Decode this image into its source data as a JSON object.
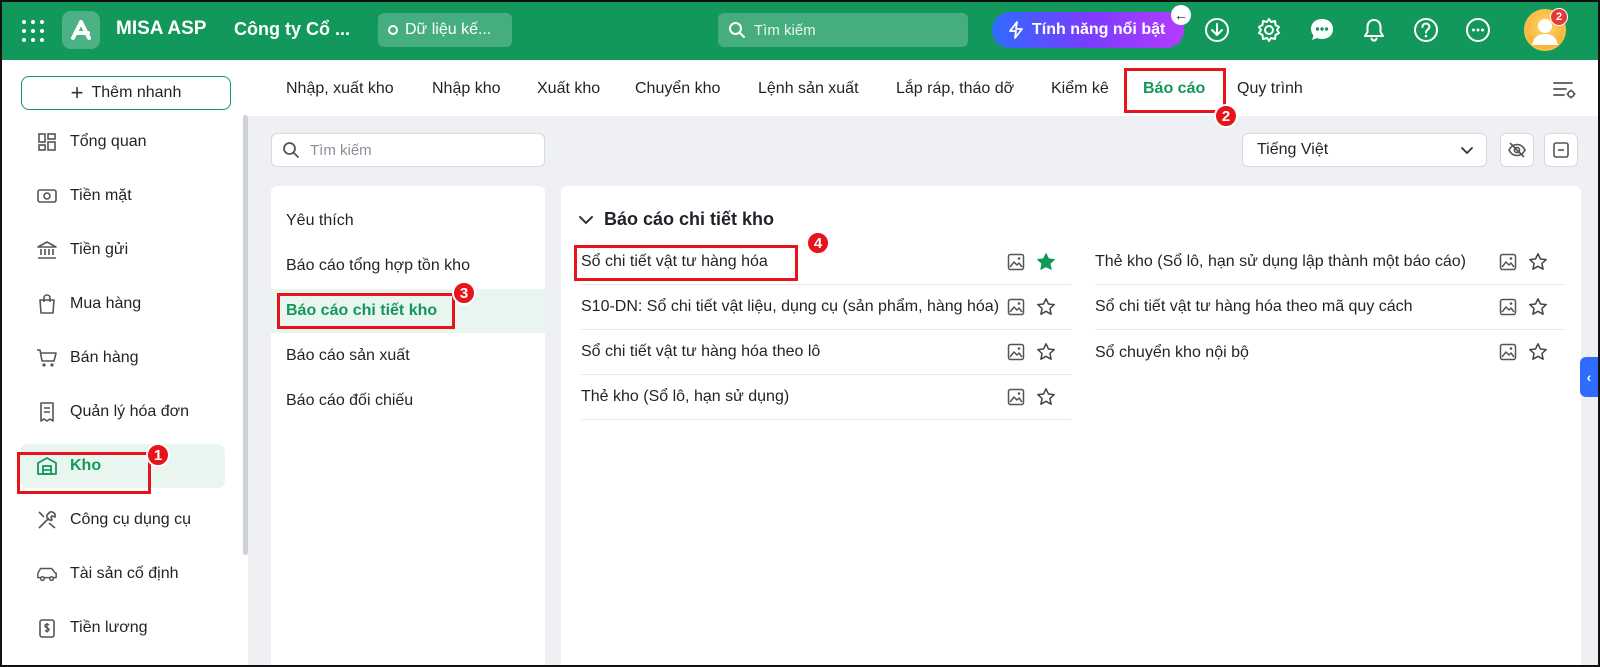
{
  "app": {
    "brand": "MISA ASP",
    "company": "Công ty Cổ ...",
    "data_label": "Dữ liệu kế...",
    "search_placeholder": "Tìm kiếm",
    "feature_button": "Tính năng nổi bật",
    "notification_count": "2"
  },
  "sidebar": {
    "quick_add": "Thêm nhanh",
    "items": [
      {
        "label": "Tổng quan"
      },
      {
        "label": "Tiền mặt"
      },
      {
        "label": "Tiền gửi"
      },
      {
        "label": "Mua hàng"
      },
      {
        "label": "Bán hàng"
      },
      {
        "label": "Quản lý hóa đơn"
      },
      {
        "label": "Kho"
      },
      {
        "label": "Công cụ dụng cụ"
      },
      {
        "label": "Tài sản cố định"
      },
      {
        "label": "Tiền lương"
      }
    ],
    "active": "Kho"
  },
  "tabs": [
    {
      "label": "Nhập, xuất kho"
    },
    {
      "label": "Nhập kho"
    },
    {
      "label": "Xuất kho"
    },
    {
      "label": "Chuyển kho"
    },
    {
      "label": "Lệnh sản xuất"
    },
    {
      "label": "Lắp ráp, tháo dỡ"
    },
    {
      "label": "Kiểm kê"
    },
    {
      "label": "Báo cáo"
    },
    {
      "label": "Quy trình"
    }
  ],
  "toolbar": {
    "search_placeholder": "Tìm kiếm",
    "language": "Tiếng Việt"
  },
  "categories": [
    {
      "label": "Yêu thích"
    },
    {
      "label": "Báo cáo tổng hợp tồn kho"
    },
    {
      "label": "Báo cáo chi tiết kho"
    },
    {
      "label": "Báo cáo sản xuất"
    },
    {
      "label": "Báo cáo đối chiếu"
    }
  ],
  "section": {
    "title": "Báo cáo chi tiết kho",
    "left_reports": [
      {
        "label": "Sổ chi tiết vật tư hàng hóa",
        "favorite": true
      },
      {
        "label": "S10-DN: Sổ chi tiết vật liệu, dụng cụ (sản phẩm, hàng hóa)",
        "favorite": false
      },
      {
        "label": "Sổ chi tiết vật tư hàng hóa theo lô",
        "favorite": false
      },
      {
        "label": "Thẻ kho (Sổ lô, hạn sử dụng)",
        "favorite": false
      }
    ],
    "right_reports": [
      {
        "label": "Thẻ kho (Sổ lô, hạn sử dụng lập thành một báo cáo)",
        "favorite": false
      },
      {
        "label": "Sổ chi tiết vật tư hàng hóa theo mã quy cách",
        "favorite": false
      },
      {
        "label": "Sổ chuyển kho nội bộ",
        "favorite": false
      }
    ]
  },
  "annotations": [
    "1",
    "2",
    "3",
    "4"
  ],
  "colors": {
    "brand_green": "#12985a",
    "highlight_red": "#e8141b",
    "active_bg": "#e9f6ef",
    "feature_gradient_start": "#2f6bff",
    "feature_gradient_end": "#b33cff"
  }
}
